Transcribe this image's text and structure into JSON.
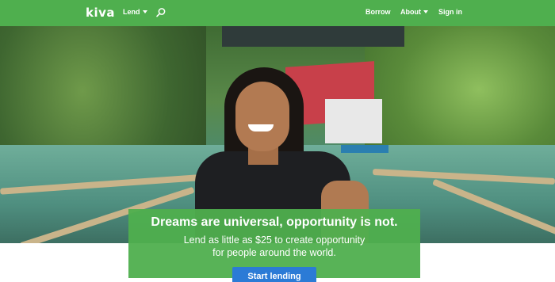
{
  "header": {
    "logo": "kiva",
    "lend_label": "Lend",
    "borrow_label": "Borrow",
    "about_label": "About",
    "signin_label": "Sign in"
  },
  "hero": {
    "headline": "Dreams are universal, opportunity is not.",
    "subline_1": "Lend as little as $25 to create opportunity",
    "subline_2": "for people around the world.",
    "cta_label": "Start lending"
  },
  "colors": {
    "brand_green": "#4faf4e",
    "cta_blue": "#2b7bd6"
  },
  "icons": {
    "search": "search-icon",
    "lend_dropdown": "chevron-down-icon",
    "about_dropdown": "chevron-down-icon"
  }
}
